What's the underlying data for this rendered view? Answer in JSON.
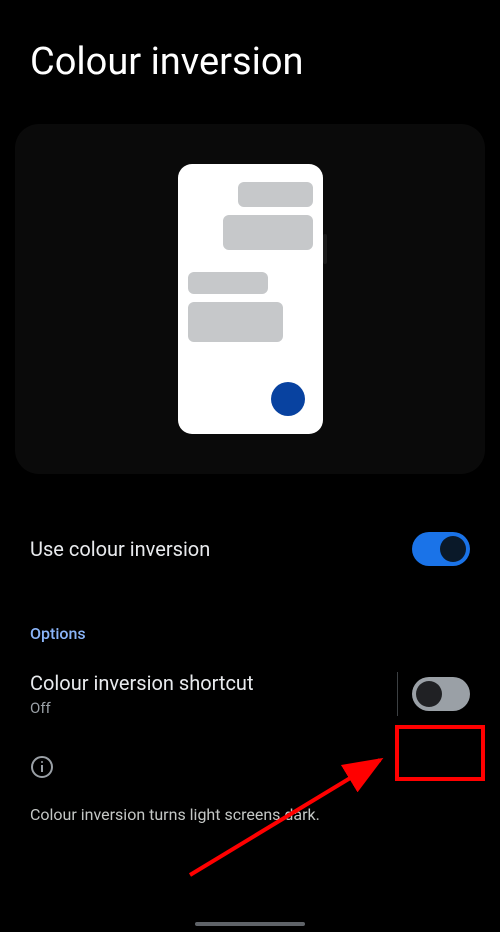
{
  "header": {
    "title": "Colour inversion"
  },
  "settings": {
    "use_inversion": {
      "label": "Use colour inversion",
      "enabled": true
    }
  },
  "sections": {
    "options_header": "Options",
    "shortcut": {
      "label": "Colour inversion shortcut",
      "status": "Off",
      "enabled": false
    }
  },
  "info": {
    "description": "Colour inversion turns light screens dark."
  },
  "annotation": {
    "highlight_target": "shortcut-toggle"
  }
}
